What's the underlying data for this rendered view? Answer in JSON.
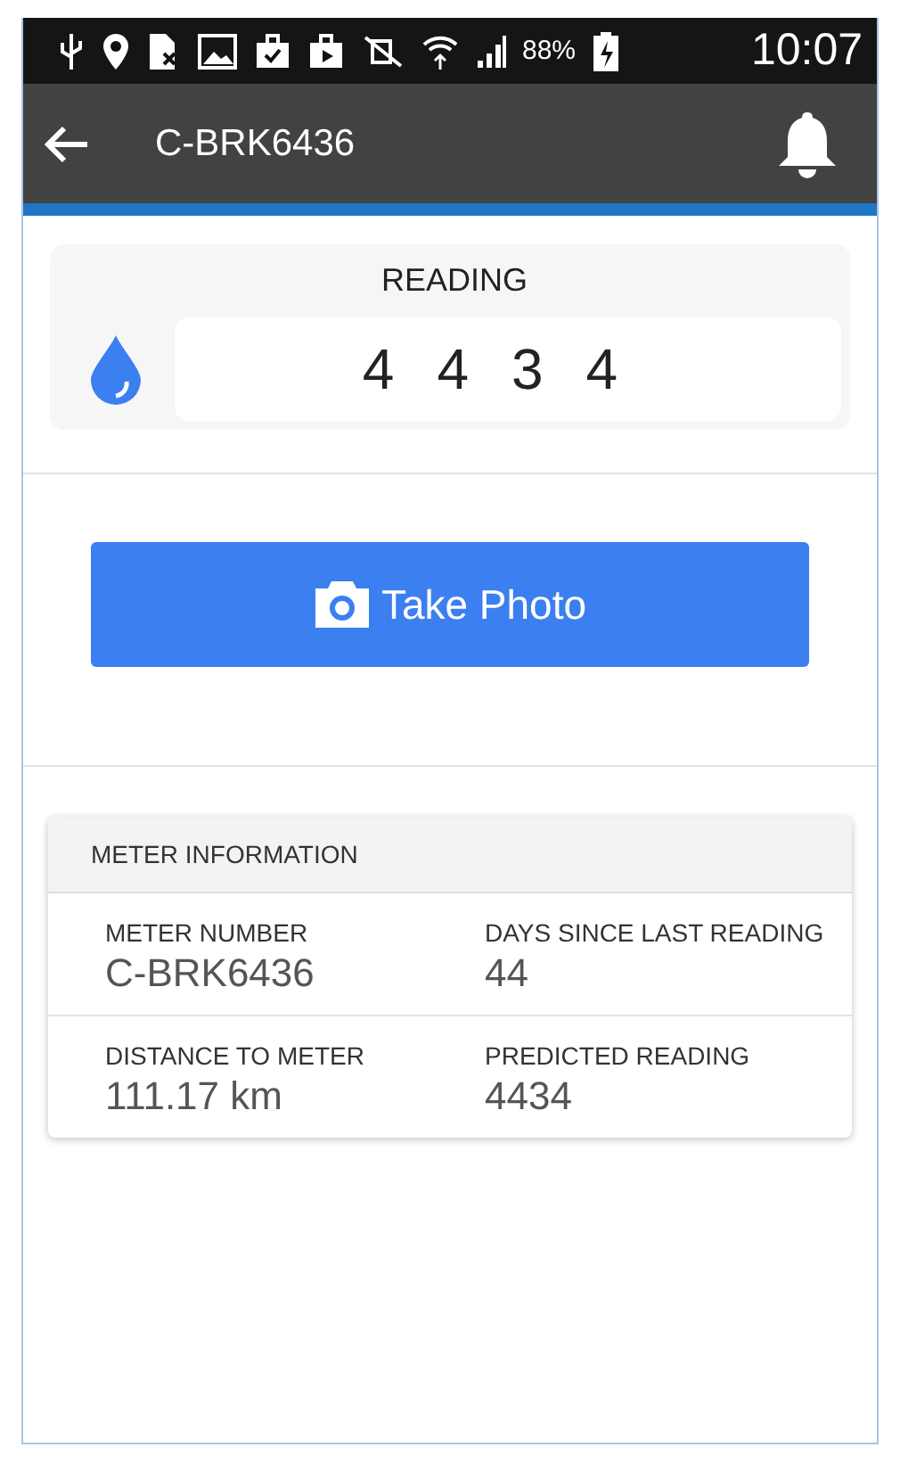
{
  "status_bar": {
    "battery": "88%",
    "time": "10:07"
  },
  "app_bar": {
    "title": "C-BRK6436"
  },
  "reading": {
    "label": "READING",
    "digits": [
      "4",
      "4",
      "3",
      "4"
    ]
  },
  "take_photo_button": {
    "label": "Take Photo"
  },
  "meter_information": {
    "title": "METER INFORMATION",
    "rows": [
      [
        {
          "label": "METER NUMBER",
          "value": "C-BRK6436"
        },
        {
          "label": "DAYS SINCE LAST READING",
          "value": "44"
        }
      ],
      [
        {
          "label": "DISTANCE TO METER",
          "value": "111.17 km"
        },
        {
          "label": "PREDICTED READING",
          "value": "4434"
        }
      ]
    ]
  }
}
